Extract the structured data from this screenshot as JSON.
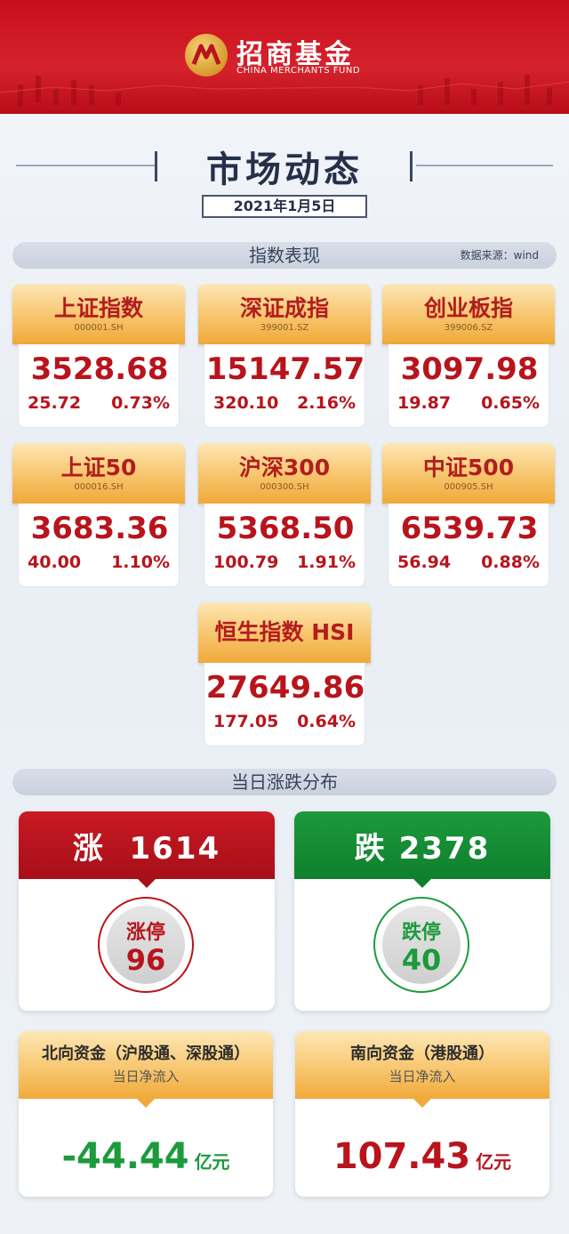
{
  "header": {
    "brand_cn": "招商基金",
    "brand_en": "CHINA MERCHANTS FUND"
  },
  "page": {
    "title": "市场动态",
    "date": "2021年1月5日"
  },
  "index_section": {
    "title": "指数表现",
    "source": "数据来源：wind"
  },
  "indices": [
    {
      "name": "上证指数",
      "code": "000001.SH",
      "value": "3528.68",
      "change": "25.72",
      "pct": "0.73%"
    },
    {
      "name": "深证成指",
      "code": "399001.SZ",
      "value": "15147.57",
      "change": "320.10",
      "pct": "2.16%"
    },
    {
      "name": "创业板指",
      "code": "399006.SZ",
      "value": "3097.98",
      "change": "19.87",
      "pct": "0.65%"
    },
    {
      "name": "上证50",
      "code": "000016.SH",
      "value": "3683.36",
      "change": "40.00",
      "pct": "1.10%"
    },
    {
      "name": "沪深300",
      "code": "000300.SH",
      "value": "5368.50",
      "change": "100.79",
      "pct": "1.91%"
    },
    {
      "name": "中证500",
      "code": "000905.SH",
      "value": "6539.73",
      "change": "56.94",
      "pct": "0.88%"
    },
    {
      "name": "恒生指数 HSI",
      "code": "",
      "value": "27649.86",
      "change": "177.05",
      "pct": "0.64%"
    }
  ],
  "distribution_section": {
    "title": "当日涨跌分布"
  },
  "up": {
    "label": "涨",
    "count": "1614",
    "limit_label": "涨停",
    "limit_count": "96"
  },
  "down": {
    "label": "跌",
    "count": "2378",
    "limit_label": "跌停",
    "limit_count": "40"
  },
  "flows": [
    {
      "title": "北向资金（沪股通、深股通）",
      "sub": "当日净流入",
      "value": "-44.44",
      "unit": "亿元"
    },
    {
      "title": "南向资金（港股通）",
      "sub": "当日净流入",
      "value": "107.43",
      "unit": "亿元"
    }
  ],
  "colors": {
    "up_red": "#b8141c",
    "down_green": "#1c9a3c",
    "gold": "#f7c46b"
  }
}
